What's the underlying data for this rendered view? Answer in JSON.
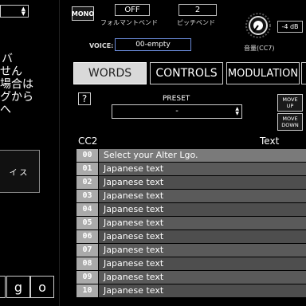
{
  "left_panel": {
    "jp_lines": [
      "バ",
      "せん",
      "場合は",
      "グから",
      "へ"
    ],
    "dark_button_label": "イス",
    "bottom_chars": [
      "g",
      "o"
    ]
  },
  "top": {
    "mono_label": "MONO",
    "formant_value": "OFF",
    "formant_label": "フォルマントベンド",
    "pitch_value": "2",
    "pitch_label": "ピッチベンド",
    "volume_value": "-4 dB",
    "volume_label": "音量(CC7)",
    "voice_label": "VOICE:",
    "voice_value": "00-empty"
  },
  "tabs": [
    {
      "label": "WORDS",
      "active": true
    },
    {
      "label": "CONTROLS",
      "active": false
    },
    {
      "label": "MODULATION",
      "active": false
    }
  ],
  "preset": {
    "help": "?",
    "label": "PRESET",
    "value": "-",
    "move_up": [
      "MOVE",
      "UP"
    ],
    "move_down": [
      "MOVE",
      "DOWN"
    ]
  },
  "table": {
    "col_cc": "CC2",
    "col_text": "Text",
    "rows": [
      {
        "idx": "00",
        "text": "Select your Alter Lgo."
      },
      {
        "idx": "01",
        "text": "Japanese text"
      },
      {
        "idx": "02",
        "text": "Japanese text"
      },
      {
        "idx": "03",
        "text": "Japanese text"
      },
      {
        "idx": "04",
        "text": "Japanese text"
      },
      {
        "idx": "05",
        "text": "Japanese text"
      },
      {
        "idx": "06",
        "text": "Japanese text"
      },
      {
        "idx": "07",
        "text": "Japanese text"
      },
      {
        "idx": "08",
        "text": "Japanese text"
      },
      {
        "idx": "09",
        "text": "Japanese text"
      },
      {
        "idx": "10",
        "text": "Japanese text"
      }
    ]
  }
}
